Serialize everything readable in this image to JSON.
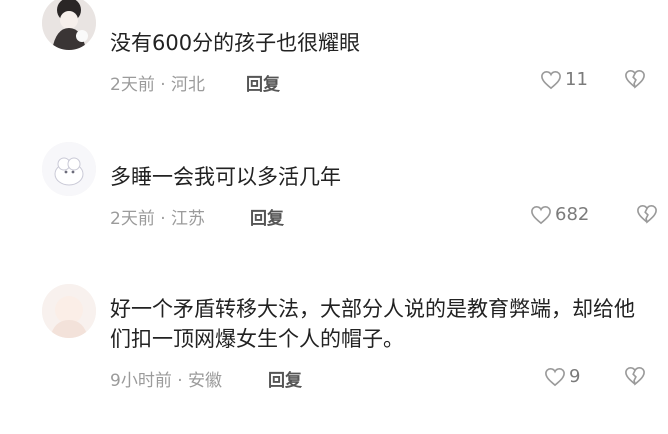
{
  "comments": [
    {
      "text": "没有600分的孩子也很耀眼",
      "meta": "2天前 · 河北",
      "reply_label": "回复",
      "likes": "11"
    },
    {
      "text": "多睡一会我可以多活几年",
      "meta": "2天前 · 江苏",
      "reply_label": "回复",
      "likes": "682"
    },
    {
      "text": "好一个矛盾转移大法，大部分人说的是教育弊端，却给他们扣一顶网爆女生个人的帽子。",
      "meta": "9小时前 · 安徽",
      "reply_label": "回复",
      "likes": "9"
    }
  ],
  "icons": {
    "like": "heart-outline-icon",
    "dislike": "broken-heart-icon"
  },
  "colors": {
    "text": "#222222",
    "meta": "#9b9b9b",
    "reply": "#555555",
    "icon": "#9a9a9a"
  }
}
